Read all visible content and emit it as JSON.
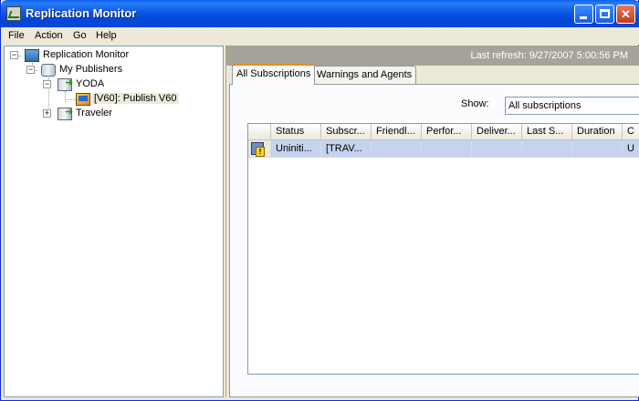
{
  "window": {
    "title": "Replication Monitor"
  },
  "menu": [
    "File",
    "Action",
    "Go",
    "Help"
  ],
  "tree": {
    "root": "Replication Monitor",
    "publishers_group": "My Publishers",
    "server1": "YODA",
    "publication": "[V60]: Publish V60",
    "server2": "Traveler"
  },
  "refresh_text": "Last refresh: 9/27/2007 5:00:56 PM",
  "tabs": [
    "All Subscriptions",
    "Warnings and Agents"
  ],
  "show": {
    "label": "Show:",
    "value": "All subscriptions"
  },
  "grid": {
    "columns": [
      "Status",
      "Subscr...",
      "Friendl...",
      "Perfor...",
      "Deliver...",
      "Last S...",
      "Duration",
      "C"
    ],
    "rows": [
      {
        "status": "Uniniti...",
        "subscription": "[TRAV...",
        "friendly": "",
        "performance": "",
        "delivery": "",
        "last_sync": "",
        "duration": "",
        "c": "U"
      }
    ]
  }
}
